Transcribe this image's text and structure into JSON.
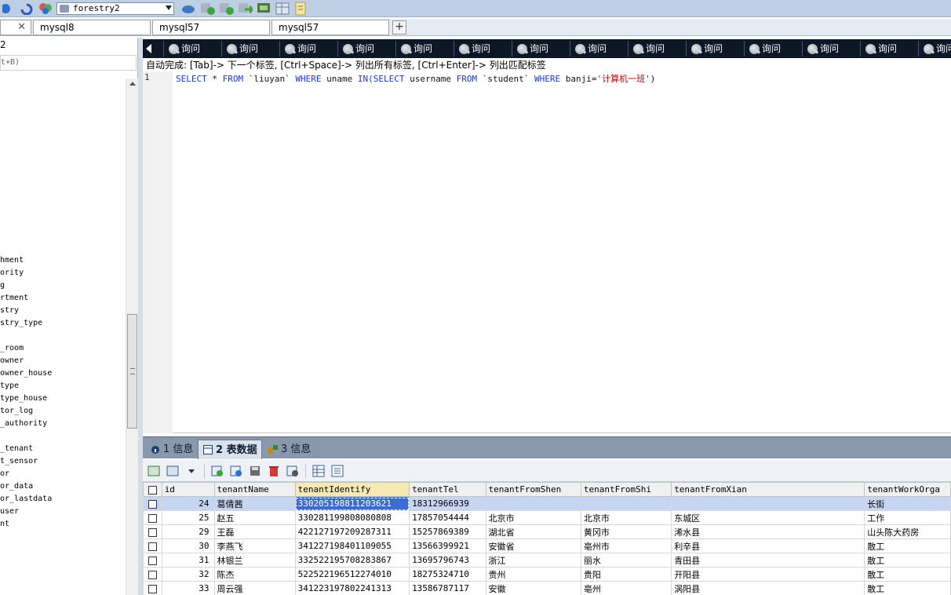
{
  "toolbar": {
    "connection_select": "forestry2",
    "icons": [
      "connect-icon",
      "refresh-icon",
      "users-icon",
      "database-dropdown",
      "schema-icon",
      "import-icon",
      "export-icon",
      "backup-icon",
      "restore-icon",
      "table-icon",
      "report-icon"
    ]
  },
  "connection_tabs": [
    {
      "label": "",
      "closable": true
    },
    {
      "label": "mysql8"
    },
    {
      "label": "mysql57"
    },
    {
      "label": "mysql57"
    }
  ],
  "sidebar": {
    "top_label": "2",
    "filter_hint": "t+B)",
    "items": [
      "hment",
      "ority",
      "g",
      "rtment",
      "stry",
      "stry_type",
      "",
      "_room",
      "owner",
      "owner_house",
      "type",
      "type_house",
      "tor_log",
      "_authority",
      "",
      "_tenant",
      "t_sensor",
      "or",
      "or_data",
      "or_lastdata",
      "user",
      "nt"
    ]
  },
  "query_tabs": {
    "labels": [
      "询问",
      "询问",
      "询问",
      "询问",
      "询问",
      "询问",
      "询问",
      "询问",
      "询问",
      "询问",
      "询问",
      "询问",
      "询问",
      "询问"
    ]
  },
  "editor": {
    "autocomplete_hint": "自动完成: [Tab]-> 下一个标签, [Ctrl+Space]-> 列出所有标签, [Ctrl+Enter]-> 列出匹配标签",
    "line_number": "1",
    "sql": {
      "k1": "SELECT",
      "t1": " * ",
      "k2": "FROM",
      "t2": " `liuyan` ",
      "k3": "WHERE",
      "t3": " uname ",
      "k4": "IN(SELECT",
      "t4": " username ",
      "k5": "FROM",
      "t5": " `student` ",
      "k6": "WHERE",
      "t6": " banji=",
      "s1": "'计算机一班'",
      "t7": ")"
    }
  },
  "result_tabs": [
    {
      "label": "1 信息",
      "active": false
    },
    {
      "label": "2 表数据",
      "active": true
    },
    {
      "label": "3 信息",
      "active": false
    }
  ],
  "grid": {
    "columns": [
      "id",
      "tenantName",
      "tenantIdentify",
      "tenantTel",
      "tenantFromShen",
      "tenantFromShi",
      "tenantFromXian",
      "tenantWorkOrga"
    ],
    "rows": [
      [
        "24",
        "葛倩茜",
        "330205198811203621",
        "18312966939",
        "",
        "",
        "",
        "长街"
      ],
      [
        "25",
        "赵五",
        "330281199808080808",
        "17857054444",
        "北京市",
        "北京市",
        "东城区",
        "工作"
      ],
      [
        "29",
        "王磊",
        "422127197209287311",
        "15257869389",
        "湖北省",
        "黄冈市",
        "浠水县",
        "山头陈大药房"
      ],
      [
        "30",
        "李燕飞",
        "341227198401109055",
        "13566399921",
        "安徽省",
        "亳州市",
        "利辛县",
        "散工"
      ],
      [
        "31",
        "林银兰",
        "332522195708283867",
        "13695796743",
        "浙江",
        "丽水",
        "青田县",
        "散工"
      ],
      [
        "32",
        "陈杰",
        "522522196512274010",
        "18275324710",
        "贵州",
        "贵阳",
        "开阳县",
        "散工"
      ],
      [
        "33",
        "周云强",
        "341223197802241313",
        "13586787117",
        "安徽",
        "亳州",
        "涡阳县",
        "散工"
      ]
    ]
  }
}
